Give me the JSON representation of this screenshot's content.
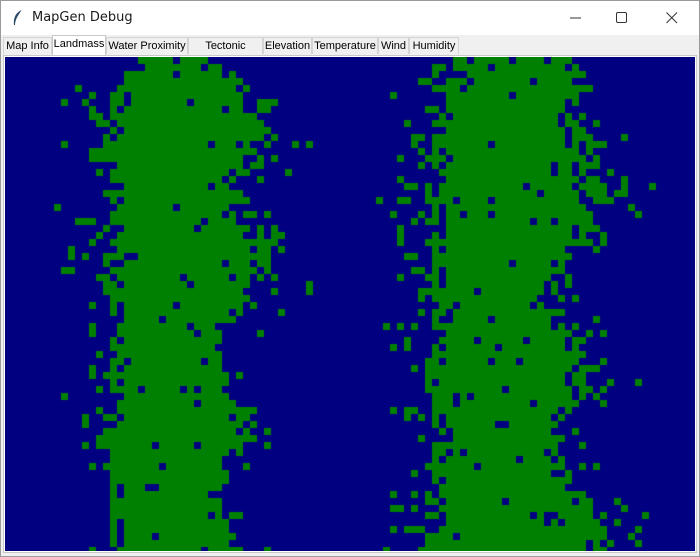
{
  "window": {
    "title": "MapGen Debug",
    "icon": "feather-icon",
    "controls": [
      "minimize-icon",
      "maximize-icon",
      "close-icon"
    ]
  },
  "tabs": [
    {
      "label": "Map Info",
      "active": false
    },
    {
      "label": "Landmass",
      "active": true
    },
    {
      "label": "Water Proximity",
      "active": false
    },
    {
      "label": "Tectonic Plates",
      "active": false
    },
    {
      "label": "Elevation",
      "active": false
    },
    {
      "label": "Temperature",
      "active": false
    },
    {
      "label": "Wind",
      "active": false
    },
    {
      "label": "Humidity",
      "active": false
    }
  ],
  "map": {
    "colors": {
      "water": "#000080",
      "land": "#008000"
    }
  }
}
